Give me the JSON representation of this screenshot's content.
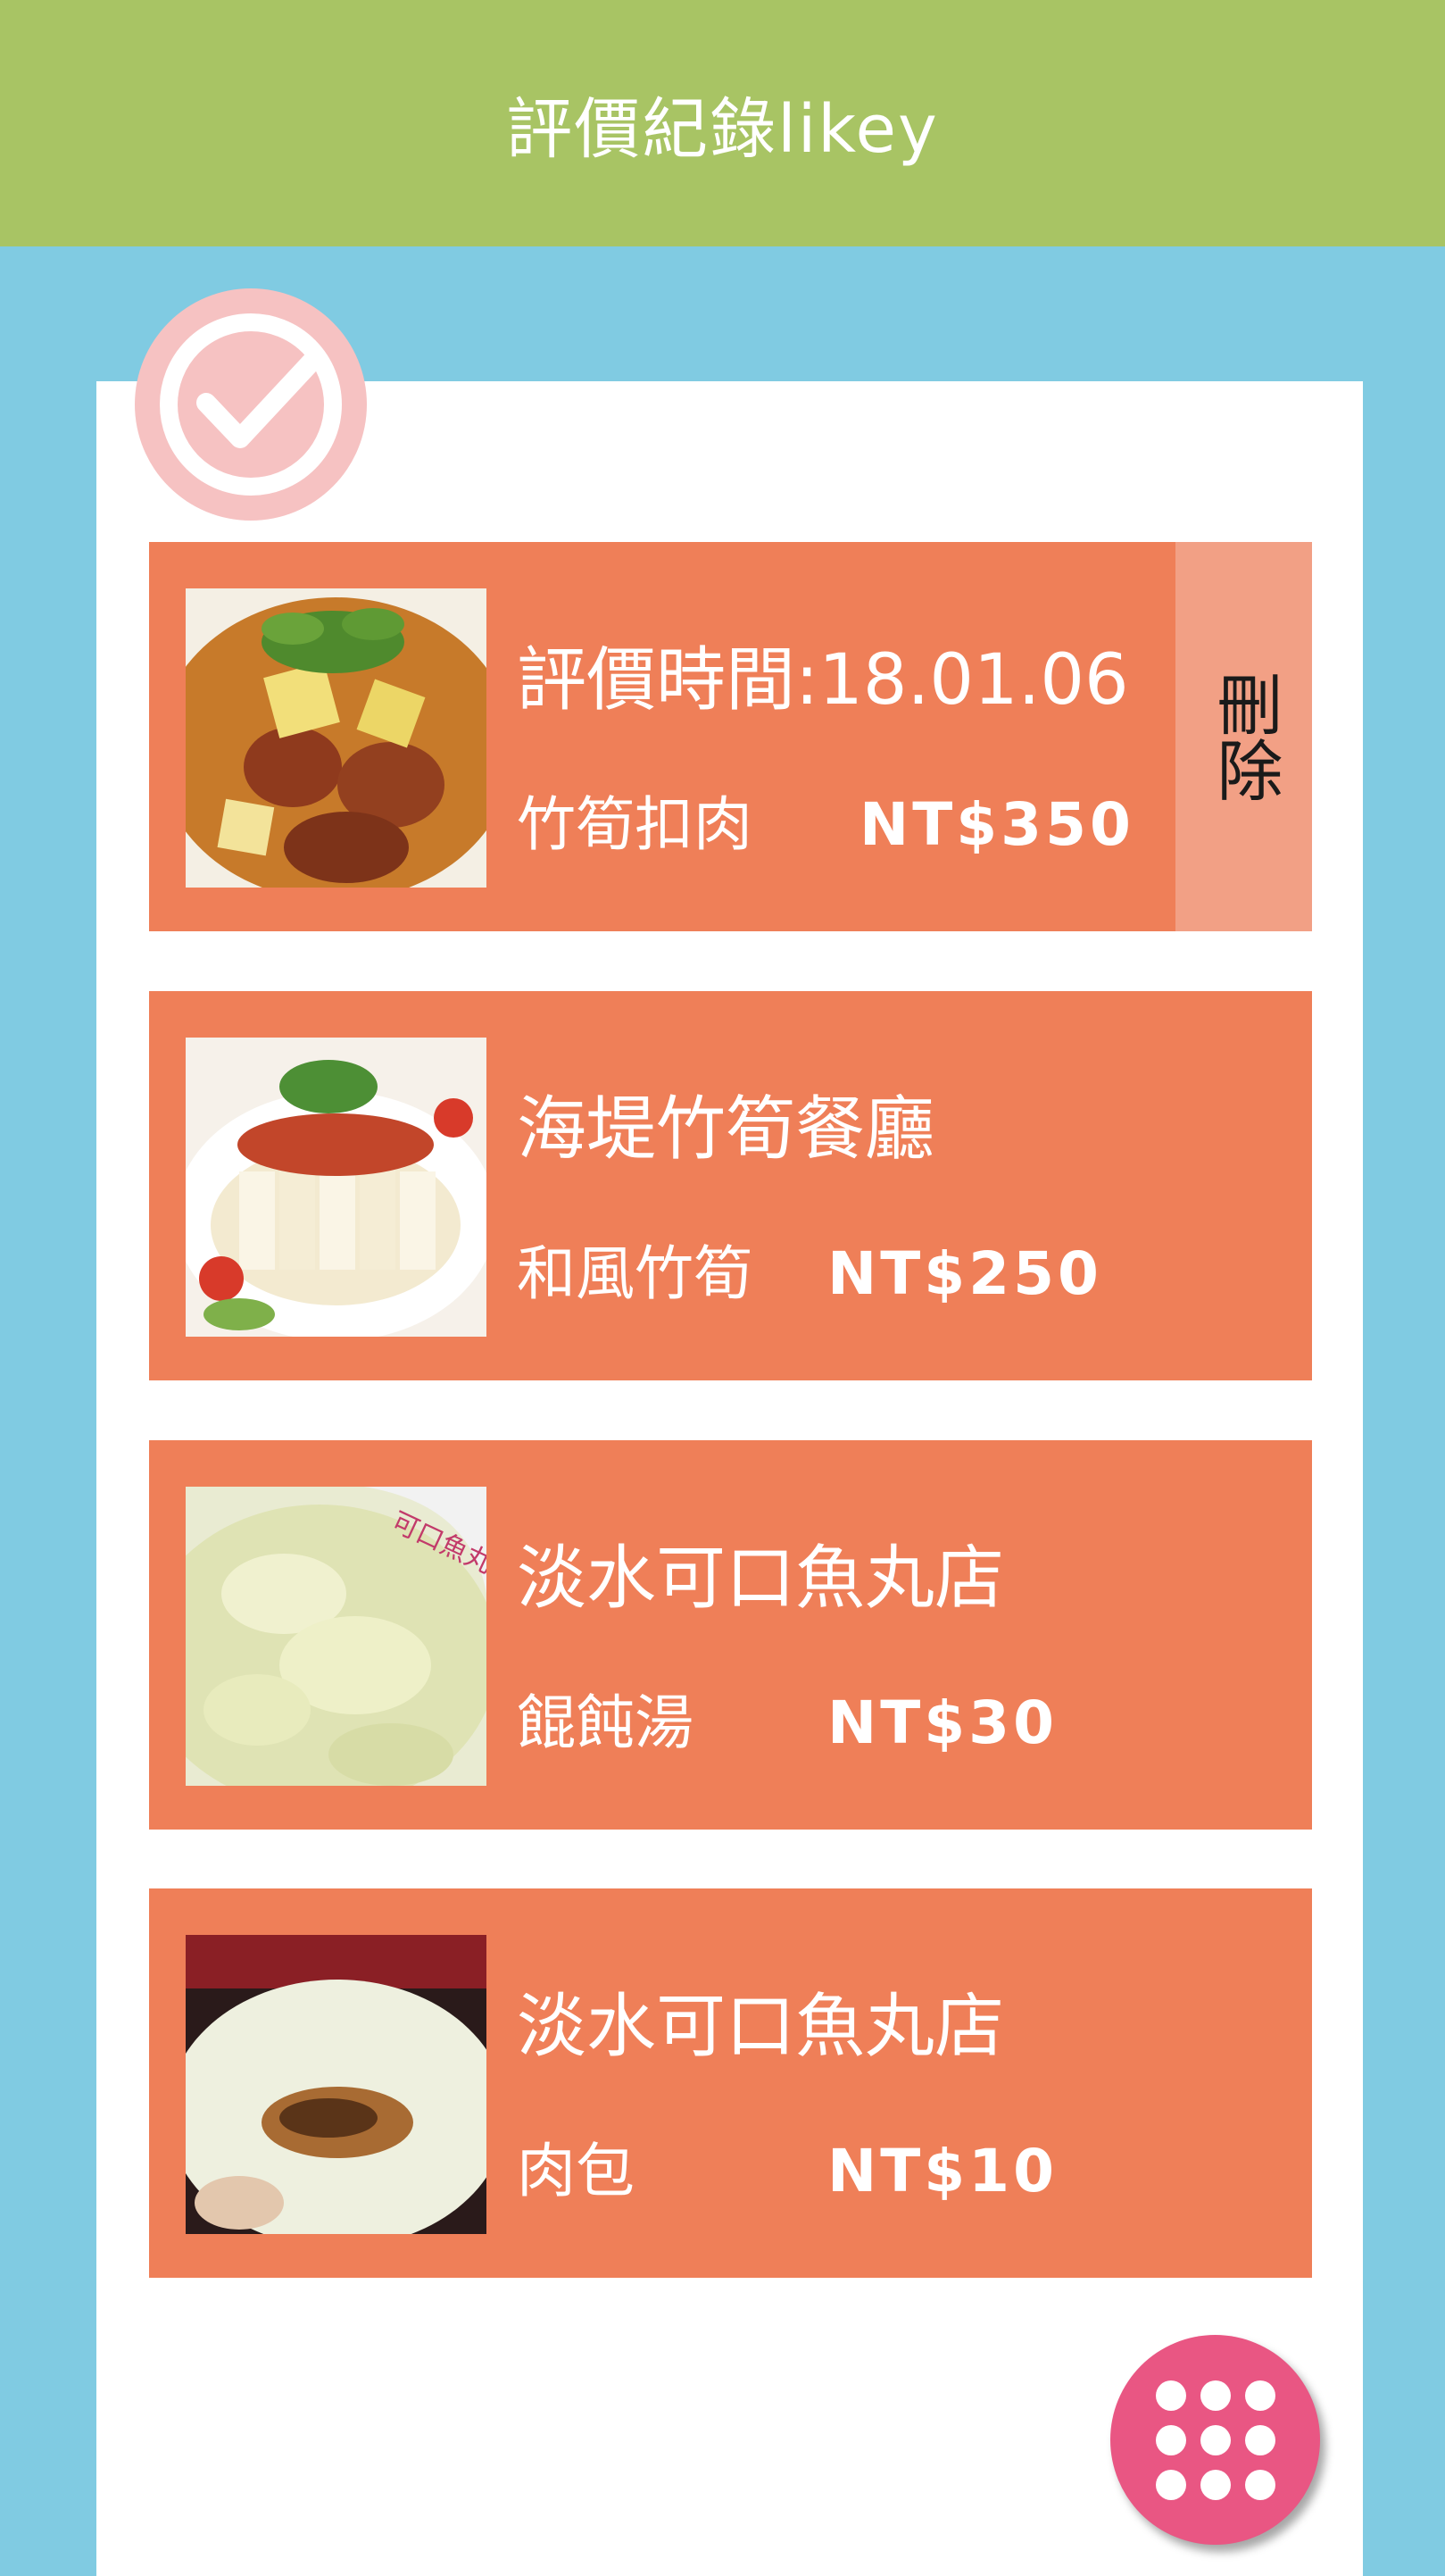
{
  "app": {
    "title": "評價紀錄likey"
  },
  "colors": {
    "header": "#a8c464",
    "background": "#80cbe2",
    "card": "#ef7f58",
    "delete": "#f2a085",
    "fab": "#e95683",
    "badge": "#f6c2c2"
  },
  "badge": {
    "icon": "check-circle-icon"
  },
  "records": [
    {
      "title": "評價時間:18.01.06",
      "dish": "竹筍扣肉",
      "price": "NT$350",
      "image_icon": "braised-pork-bamboo-photo"
    },
    {
      "title": "海堤竹筍餐廳",
      "dish": "和風竹筍",
      "price": "NT$250",
      "image_icon": "bamboo-shoot-salad-photo"
    },
    {
      "title": "淡水可口魚丸店",
      "dish": "餛飩湯",
      "price": "NT$30",
      "image_icon": "wonton-soup-photo"
    },
    {
      "title": "淡水可口魚丸店",
      "dish": "肉包",
      "price": "NT$10",
      "image_icon": "meat-bun-photo"
    }
  ],
  "delete_label": "刪除",
  "fab": {
    "icon": "app-grid-icon"
  }
}
